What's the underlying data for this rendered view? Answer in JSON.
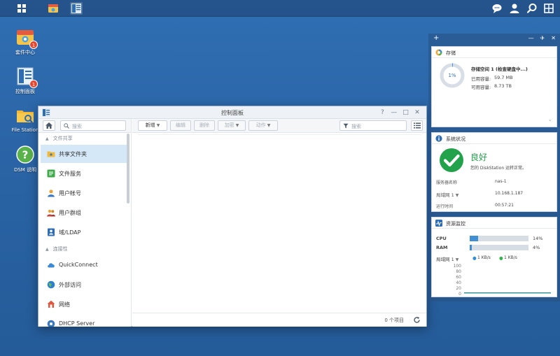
{
  "taskbar": {
    "icons": [
      "main-menu-icon",
      "package-center-icon",
      "control-panel-icon",
      "chat-icon",
      "user-icon",
      "search-icon",
      "widgets-icon"
    ]
  },
  "desktop": {
    "icons": [
      {
        "label": "套件中心",
        "badge": "1"
      },
      {
        "label": "控制面板",
        "badge": "1"
      },
      {
        "label": "File Station"
      },
      {
        "label": "DSM 说明"
      }
    ]
  },
  "window": {
    "title": "控制面板",
    "controls": [
      "?",
      "—",
      "□",
      "✕"
    ],
    "search_left_placeholder": "搜索",
    "search_right_placeholder": "搜索",
    "toolbar": {
      "new": "新增",
      "edit": "编辑",
      "delete": "删除",
      "encrypt": "加密",
      "action": "动作"
    },
    "sidebar": {
      "sections": [
        "文件共享",
        "连接性"
      ],
      "items": [
        {
          "label": "共享文件夹",
          "active": true
        },
        {
          "label": "文件服务"
        },
        {
          "label": "用户帐号"
        },
        {
          "label": "用户群组"
        },
        {
          "label": "域/LDAP"
        },
        {
          "label": "QuickConnect"
        },
        {
          "label": "外部访问"
        },
        {
          "label": "网络"
        },
        {
          "label": "DHCP Server"
        }
      ]
    },
    "footer": {
      "count": "0 个项目"
    }
  },
  "widgets": {
    "storage": {
      "title": "存储",
      "percent": "1%",
      "volume": "存储空间 1 (检查硬盘中...)",
      "used_label": "已用容量:",
      "used_value": "59.7 MB",
      "free_label": "可用容量:",
      "free_value": "8.73 TB"
    },
    "system": {
      "title": "系统状况",
      "status": "良好",
      "message": "您的 DiskStation 运转正常。",
      "rows": [
        {
          "label": "服务器名称",
          "value": "nas-1"
        },
        {
          "label": "局域网 1",
          "value": "10.168.1.187"
        },
        {
          "label": "运行时间",
          "value": "00:57:21"
        }
      ]
    },
    "monitor": {
      "title": "资源监控",
      "cpu_label": "CPU",
      "cpu_value": "14%",
      "cpu_fraction": 0.14,
      "ram_label": "RAM",
      "ram_value": "4%",
      "ram_fraction": 0.04,
      "lan_label": "局域网 1",
      "upload": "1 KB/s",
      "download": "1 KB/s",
      "chart_ticks": [
        "100",
        "80",
        "60",
        "40",
        "20",
        "0"
      ]
    }
  },
  "colors": {
    "desktop_bg": "#2b65a7",
    "accent": "#3f8fd4",
    "good_green": "#22a24a",
    "upload_dot": "#2f8fd8",
    "download_dot": "#34b44a"
  }
}
